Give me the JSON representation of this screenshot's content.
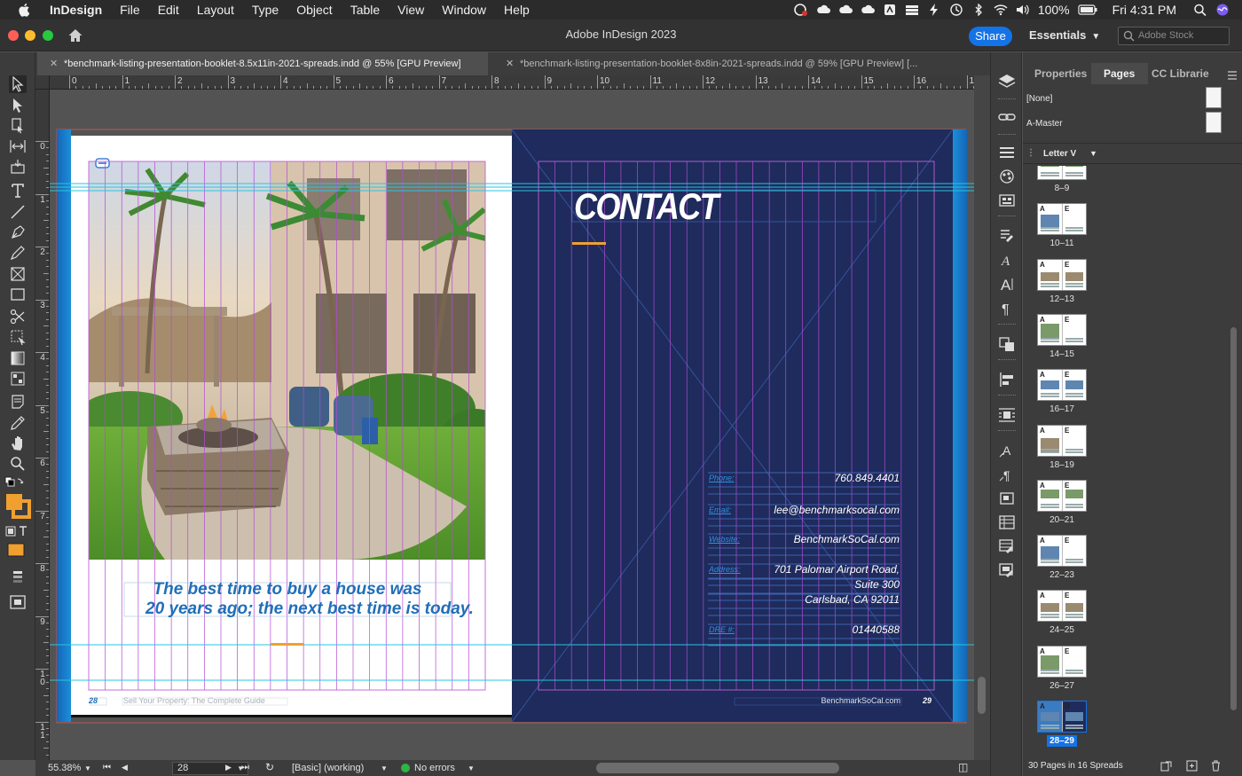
{
  "menubar": {
    "app_name": "InDesign",
    "items": [
      "File",
      "Edit",
      "Layout",
      "Type",
      "Object",
      "Table",
      "View",
      "Window",
      "Help"
    ],
    "battery": "100%",
    "clock": "Fri 4:31 PM"
  },
  "window": {
    "title": "Adobe InDesign 2023",
    "share_label": "Share",
    "workspace": "Essentials",
    "stock_placeholder": "Adobe Stock"
  },
  "tabs": [
    {
      "label": "*benchmark-listing-presentation-booklet-8.5x11in-2021-spreads.indd @ 55% [GPU Preview]",
      "active": true
    },
    {
      "label": "*benchmark-listing-presentation-booklet-8x8in-2021-spreads.indd @ 59% [GPU Preview] [...",
      "active": false
    }
  ],
  "ruler": {
    "top": [
      "0",
      "1",
      "2",
      "3",
      "4",
      "5",
      "6",
      "7",
      "8",
      "9",
      "10",
      "11",
      "12",
      "13",
      "14",
      "15",
      "16",
      "17"
    ],
    "left": [
      "0",
      "1",
      "2",
      "3",
      "4",
      "5",
      "6",
      "7",
      "8",
      "9",
      "10",
      "11"
    ]
  },
  "spread": {
    "left_page": {
      "quote_line1": "The best time to buy a house was",
      "quote_line2": "20 years ago; the next best time is today.",
      "page_number": "28",
      "footer": "Sell Your Property: The Complete Guide"
    },
    "right_page": {
      "heading": "CONTACT",
      "fields": [
        {
          "label": "Phone:",
          "value": "760.849.4401"
        },
        {
          "label": "Email:",
          "value": "lee@benchmarksocal.com"
        },
        {
          "label": "Website:",
          "value": "BenchmarkSoCal.com"
        },
        {
          "label": "Address:",
          "value": "701 Palomar Airport Road,"
        },
        {
          "label": "",
          "value": "Suite 300"
        },
        {
          "label": "",
          "value": "Carlsbad, CA 92011"
        },
        {
          "label": "DRE #:",
          "value": "01440588"
        }
      ],
      "footer": "BenchmarkSoCal.com",
      "page_number": "29"
    }
  },
  "status": {
    "zoom": "55.38%",
    "page": "28",
    "style": "[Basic] (working)",
    "preflight": "No errors"
  },
  "panel": {
    "tabs": [
      "Properties",
      "Pages",
      "CC Librarie"
    ],
    "masters": [
      "[None]",
      "A-Master"
    ],
    "size_label": "Letter V",
    "spreads": [
      {
        "label": "8–9",
        "masters": [
          "",
          ""
        ]
      },
      {
        "label": "10–11",
        "masters": [
          "A",
          "E"
        ]
      },
      {
        "label": "12–13",
        "masters": [
          "A",
          "E"
        ]
      },
      {
        "label": "14–15",
        "masters": [
          "A",
          "E"
        ]
      },
      {
        "label": "16–17",
        "masters": [
          "A",
          "E"
        ]
      },
      {
        "label": "18–19",
        "masters": [
          "A",
          "E"
        ]
      },
      {
        "label": "20–21",
        "masters": [
          "A",
          "E"
        ]
      },
      {
        "label": "22–23",
        "masters": [
          "A",
          "E"
        ]
      },
      {
        "label": "24–25",
        "masters": [
          "A",
          "E"
        ]
      },
      {
        "label": "26–27",
        "masters": [
          "A",
          "E"
        ]
      },
      {
        "label": "28–29",
        "masters": [
          "A",
          "D"
        ]
      }
    ],
    "footer": "30 Pages in 16 Spreads"
  },
  "colors": {
    "accent": "#1473e6",
    "contact_bg": "#1e2b5c",
    "quote_blue": "#1f6fb8",
    "orange": "#f0a030",
    "guide_purple": "#b44ad6",
    "guide_cyan": "#27c6e0"
  }
}
